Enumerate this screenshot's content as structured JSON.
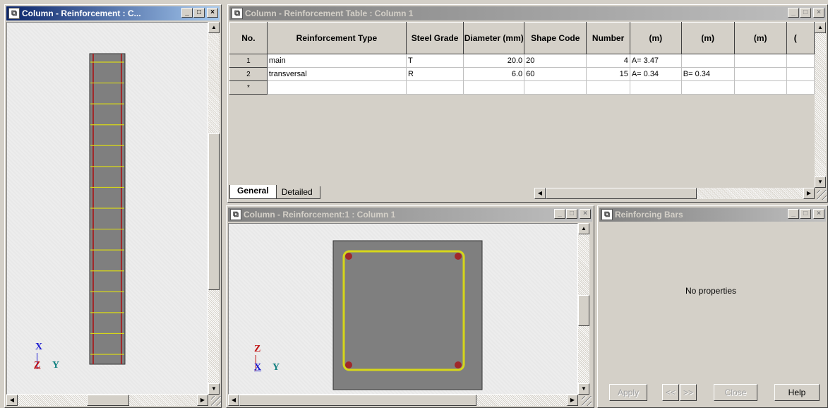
{
  "left_window": {
    "title": "Column - Reinforcement : C..."
  },
  "table_window": {
    "title": "Column - Reinforcement Table : Column 1",
    "headers": [
      "No.",
      "Reinforcement Type",
      "Steel Grade",
      "Diameter (mm)",
      "Shape Code",
      "Number",
      "(m)",
      "(m)",
      "(m)",
      "("
    ],
    "rows": [
      [
        "1",
        "main",
        "T",
        "20.0",
        "20",
        "4",
        "A= 3.47",
        "",
        "",
        ""
      ],
      [
        "2",
        "transversal",
        "R",
        "6.0",
        "60",
        "15",
        "A= 0.34",
        "B= 0.34",
        "",
        ""
      ],
      [
        "*",
        "",
        "",
        "",
        "",
        "",
        "",
        "",
        "",
        ""
      ]
    ],
    "tabs": [
      "General",
      "Detailed"
    ],
    "selected_tab": "General"
  },
  "section_window": {
    "title": "Column - Reinforcement:1 : Column 1"
  },
  "bars_window": {
    "title": "Reinforcing Bars",
    "message": "No properties",
    "buttons": {
      "apply": "Apply",
      "prev": "<<",
      "next": ">>",
      "close": "Close",
      "help": "Help"
    }
  },
  "axes": {
    "elevation": {
      "up": "X",
      "left": "Z",
      "right": "Y"
    },
    "section": {
      "up": "Z",
      "left": "X",
      "right": "Y"
    }
  },
  "colors": {
    "title_active": "#0a246a",
    "concrete": "#7f7f7f",
    "rebar_main": "#a0282a",
    "stirrup": "#d6d61a"
  }
}
